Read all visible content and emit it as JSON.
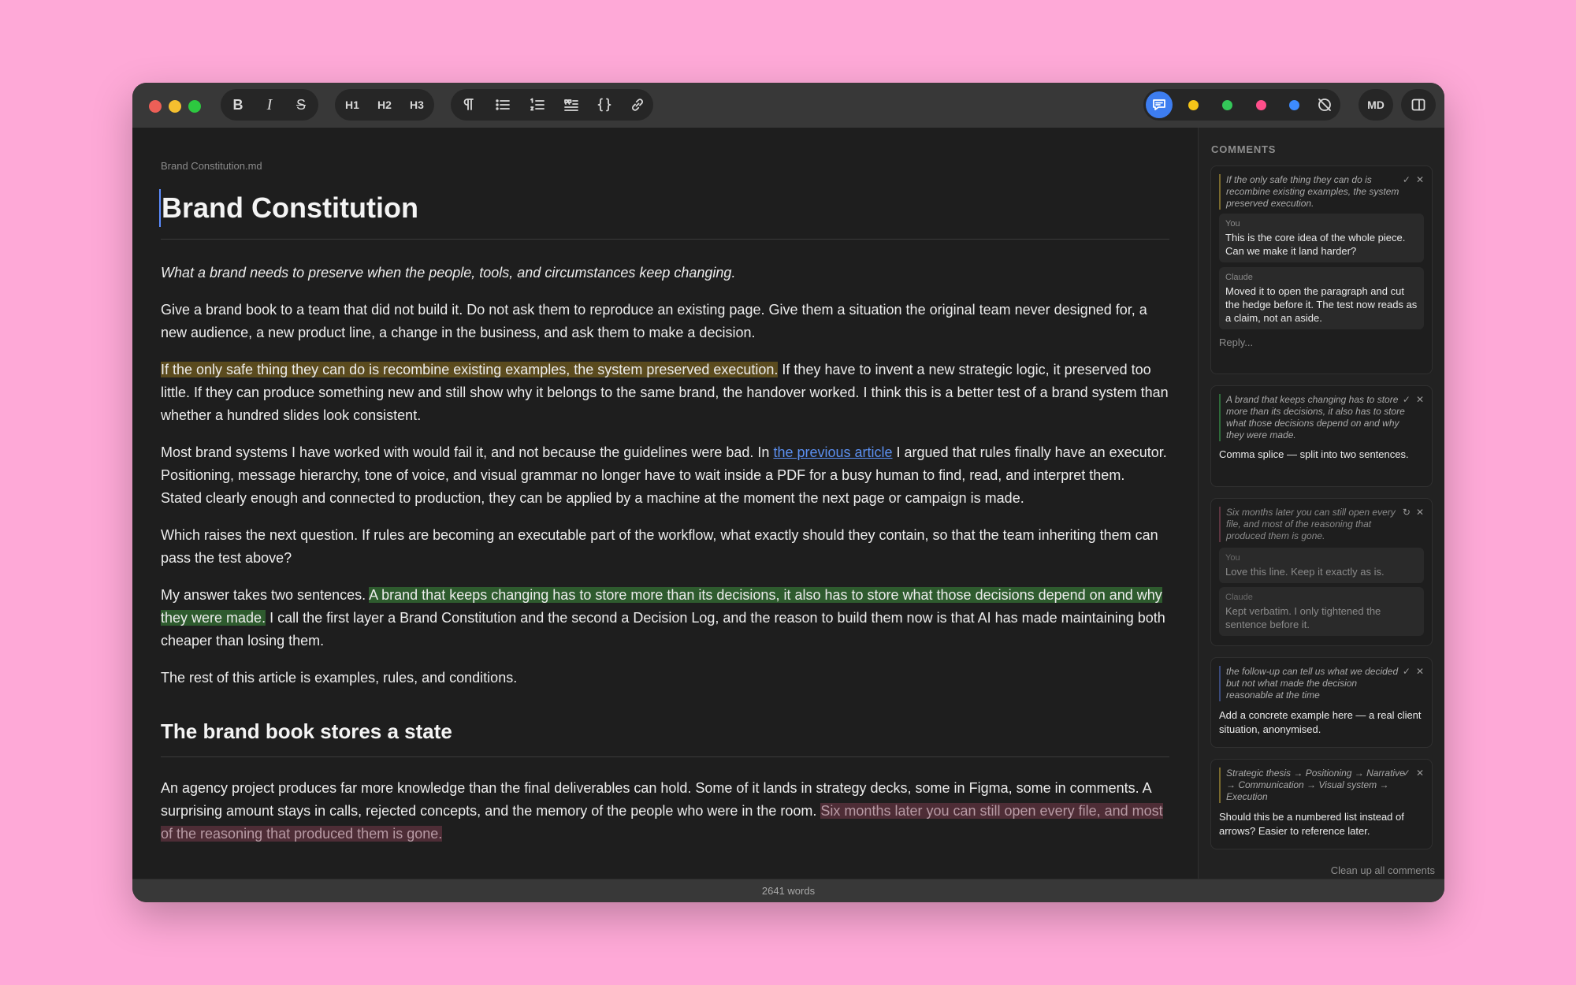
{
  "toolbar": {
    "format": [
      "B",
      "I",
      "S"
    ],
    "headings": [
      "H1",
      "H2",
      "H3"
    ],
    "md_label": "MD",
    "colors": {
      "yellow": "#f5c518",
      "green": "#34c759",
      "pink": "#ff4f8b",
      "blue": "#3d8bff",
      "accent": "#3d7df0"
    }
  },
  "editor": {
    "filename": "Brand Constitution.md",
    "title": "Brand Constitution",
    "subtitle": "What a brand needs to preserve when the people, tools, and circumstances keep changing.",
    "p1": "Give a brand book to a team that did not build it. Do not ask them to reproduce an existing page. Give them a situation the original team never designed for, a new audience, a new product line, a change in the business, and ask them to make a decision.",
    "p2_highlight": "If the only safe thing they can do is recombine existing examples, the system preserved execution.",
    "p2_rest": " If they have to invent a new strategic logic, it preserved too little. If they can produce something new and still show why it belongs to the same brand, the handover worked. I think this is a better test of a brand system than whether a hundred slides look consistent.",
    "p3_a": "Most brand systems I have worked with would fail it, and not because the guidelines were bad. In ",
    "p3_link": "the previous article",
    "p3_b": " I argued that rules finally have an executor. Positioning, message hierarchy, tone of voice, and visual grammar no longer have to wait inside a PDF for a busy human to find, read, and interpret them. Stated clearly enough and connected to production, they can be applied by a machine at the moment the next page or campaign is made.",
    "p4": "Which raises the next question. If rules are becoming an executable part of the workflow, what exactly should they contain, so that the team inheriting them can pass the test above?",
    "p5_a": "My answer takes two sentences. ",
    "p5_highlight": "A brand that keeps changing has to store more than its decisions, it also has to store what those decisions depend on and why they were made.",
    "p5_b": " I call the first layer a Brand Constitution and the second a Decision Log, and the reason to build them now is that AI has made maintaining both cheaper than losing them.",
    "p6": "The rest of this article is examples, rules, and conditions.",
    "h2": "The brand book stores a state",
    "p7_a": "An agency project produces far more knowledge than the final deliverables can hold. Some of it lands in strategy decks, some in Figma, some in comments. A surprising amount stays in calls, rejected concepts, and the memory of the people who were in the room. ",
    "p7_highlight": "Six months later you can still open every file, and most of the reasoning that produced them is gone."
  },
  "sidebar": {
    "title": "COMMENTS",
    "cleanup": "Clean up all comments",
    "comments": [
      {
        "quote": "If the only safe thing they can do is recombine existing examples, the system preserved execution.",
        "m1_who": "You",
        "m1_txt": "This is the core idea of the whole piece. Can we make it land harder?",
        "m2_who": "Claude",
        "m2_txt": "Moved it to open the paragraph and cut the hedge before it. The test now reads as a claim, not an aside.",
        "reply": "Reply..."
      },
      {
        "quote": "A brand that keeps changing has to store more than its decisions, it also has to store what those decisions depend on and why they were made.",
        "body": "Comma splice — split into two sentences."
      },
      {
        "quote": "Six months later you can still open every file, and most of the reasoning that produced them is gone.",
        "m1_who": "You",
        "m1_txt": "Love this line. Keep it exactly as is.",
        "m2_who": "Claude",
        "m2_txt": "Kept verbatim. I only tightened the sentence before it."
      },
      {
        "quote": "the follow-up can tell us what we decided but not what made the decision reasonable at the time",
        "body": "Add a concrete example here — a real client situation, anonymised."
      },
      {
        "quote": "Strategic thesis → Positioning → Narrative → Communication → Visual system → Execution",
        "body": "Should this be a numbered list instead of arrows? Easier to reference later."
      }
    ]
  },
  "status": {
    "words": "2641 words"
  }
}
